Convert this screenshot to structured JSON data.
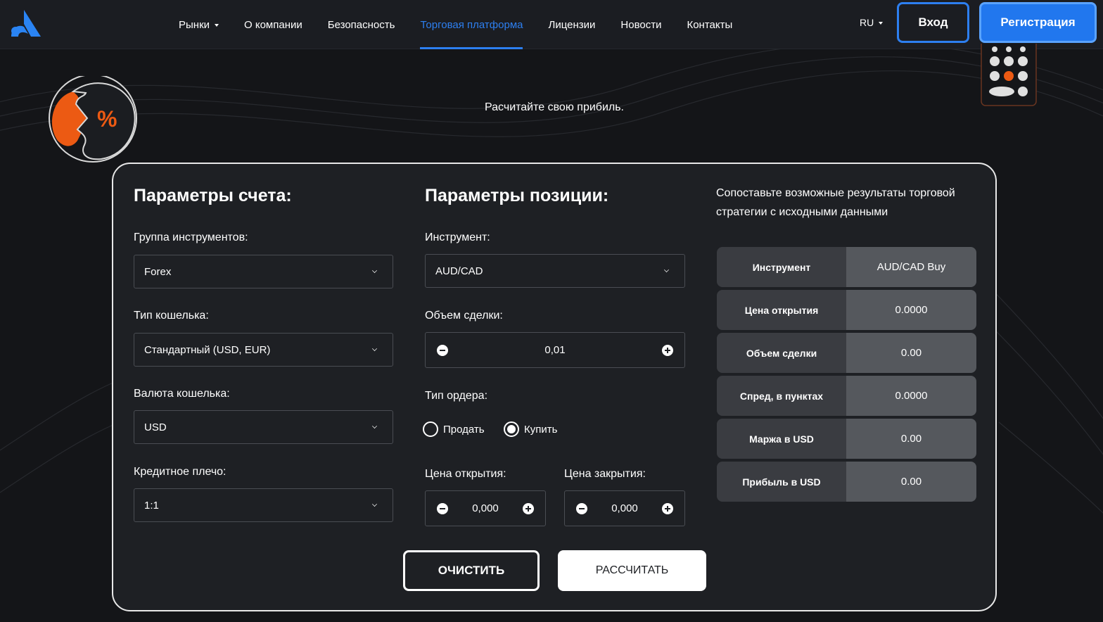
{
  "header": {
    "nav": [
      {
        "label": "Рынки",
        "has_dropdown": true,
        "active": false
      },
      {
        "label": "О компании",
        "has_dropdown": false,
        "active": false
      },
      {
        "label": "Безопасность",
        "has_dropdown": false,
        "active": false
      },
      {
        "label": "Торговая платформа",
        "has_dropdown": false,
        "active": true
      },
      {
        "label": "Лицензии",
        "has_dropdown": false,
        "active": false
      },
      {
        "label": "Новости",
        "has_dropdown": false,
        "active": false
      },
      {
        "label": "Контакты",
        "has_dropdown": false,
        "active": false
      }
    ],
    "language": "RU",
    "login_label": "Вход",
    "register_label": "Регистрация"
  },
  "hero": {
    "subtitle": "Расчитайте свою прибиль.",
    "percent_glyph": "%"
  },
  "account": {
    "title": "Параметры счета:",
    "instrument_group": {
      "label": "Группа инструментов:",
      "value": "Forex"
    },
    "wallet_type": {
      "label": "Тип кошелька:",
      "value": "Стандартный (USD, EUR)"
    },
    "wallet_currency": {
      "label": "Валюта кошелька:",
      "value": "USD"
    },
    "leverage": {
      "label": "Кредитное плечо:",
      "value": "1:1"
    }
  },
  "position": {
    "title": "Параметры позиции:",
    "instrument": {
      "label": "Инструмент:",
      "value": "AUD/CAD"
    },
    "volume": {
      "label": "Объем сделки:",
      "value": "0,01"
    },
    "order_type": {
      "label": "Тип ордера:",
      "sell_label": "Продать",
      "buy_label": "Купить",
      "selected": "buy"
    },
    "open_price": {
      "label": "Цена открытия:",
      "value": "0,000"
    },
    "close_price": {
      "label": "Цена закрытия:",
      "value": "0,000"
    }
  },
  "results": {
    "intro": "Сопоставьте возможные результаты торговой стратегии с исходными данными",
    "rows": [
      {
        "key": "Инструмент",
        "value": "AUD/CAD Buy"
      },
      {
        "key": "Цена открытия",
        "value": "0.0000"
      },
      {
        "key": "Объем сделки",
        "value": "0.00"
      },
      {
        "key": "Спред, в пунктах",
        "value": "0.0000"
      },
      {
        "key": "Маржа в USD",
        "value": "0.00"
      },
      {
        "key": "Прибыль в USD",
        "value": "0.00"
      }
    ]
  },
  "actions": {
    "clear_label": "ОЧИСТИТЬ",
    "calculate_label": "РАССЧИТАТЬ"
  },
  "colors": {
    "accent": "#2d7ff0",
    "brand_orange": "#ec5a13",
    "background": "#141518",
    "card": "#1e2024"
  },
  "icons": [
    "logo-icon",
    "percent-icon",
    "calculator-icon",
    "chevron-down-icon",
    "minus-icon",
    "plus-icon"
  ]
}
